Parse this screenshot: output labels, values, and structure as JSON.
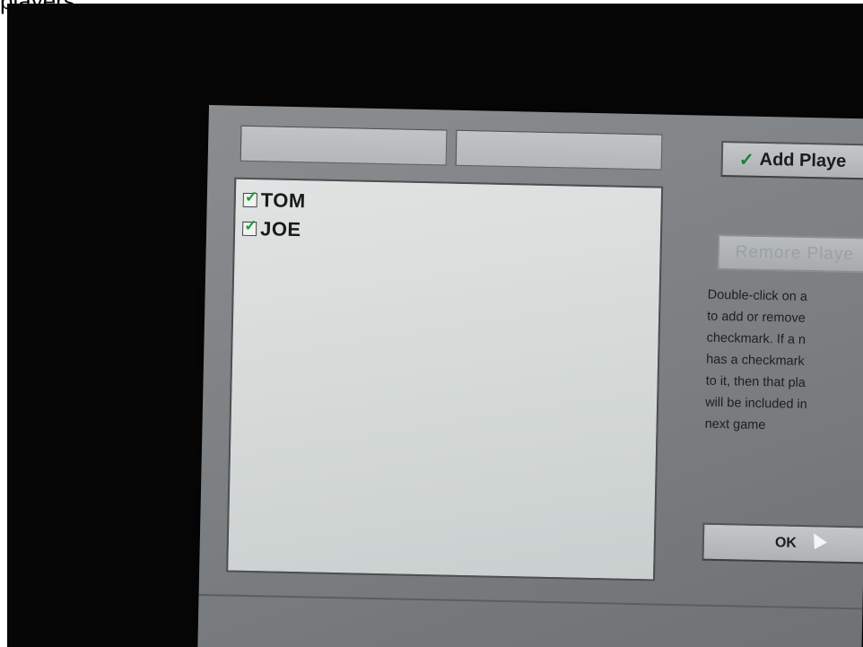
{
  "caption": "players",
  "dialog": {
    "name_field_1_value": "",
    "name_field_2_value": "",
    "players": [
      {
        "name": "TOM",
        "checked": true
      },
      {
        "name": "JOE",
        "checked": true
      }
    ],
    "add_button_label": "Add Playe",
    "add_button_check": "✓",
    "remove_button_label": "Remore Playe",
    "help_text": "Double-click on a\nto add or remove\ncheckmark. If a n\nhas a checkmark\nto it, then that pla\nwill be included in\nnext game",
    "ok_button_label": "OK"
  },
  "colors": {
    "dialog_bg": "#7f8284",
    "list_bg": "#d8dcdb",
    "check_green": "#1f9a3a"
  }
}
